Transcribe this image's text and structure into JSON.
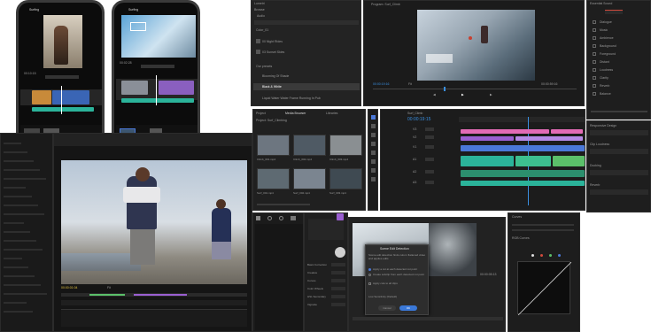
{
  "phones": {
    "left": {
      "title": "Surfing",
      "time": "00:10:15",
      "tools": [
        "Photos",
        "Media",
        "Text",
        "Audio"
      ]
    },
    "right": {
      "title": "Surfing",
      "time": "00:02:28",
      "tools": [
        "Photos",
        "Media",
        "Text",
        "Audio"
      ]
    }
  },
  "lumetri_list": {
    "header": "Lumetri",
    "tabs": [
      "Browse",
      "Audio"
    ],
    "section_title": "Color_01",
    "items": [
      "00 Night Rides",
      "03 Sunset Skies",
      "Run Sequences"
    ],
    "section2": "Our presets",
    "items2": [
      "Blooming Of Shade",
      "Black & White",
      "Liquid Water Water Frame Running In Pub"
    ]
  },
  "program_monitor": {
    "title": "Program: Surf_Climb",
    "timecode_left": "00:00:19:16",
    "timecode_right": "00:00:59:16",
    "fit": "Fit"
  },
  "project": {
    "title": "Project: Surf_Climbing",
    "tabs": [
      "Project",
      "Media Browser",
      "Libraries"
    ],
    "clip_labels": [
      "Climb_001.mp4",
      "Climb_002.mp4",
      "Climb_003.mp4",
      "Surf_001.mp4",
      "Surf_002.mp4",
      "Surf_003.mp4"
    ]
  },
  "timeline": {
    "title": "Surf_Climb",
    "timecode": "00:00:19:15",
    "tracks": [
      "V3",
      "V2",
      "V1",
      "A1",
      "A2",
      "A3"
    ]
  },
  "essential_sound": {
    "title": "Essential Sound",
    "items": [
      "Dialogue",
      "Music",
      "Ambience",
      "Background",
      "Foreground",
      "Distant",
      "Loudness",
      "Clarity",
      "Reverb",
      "Balance"
    ]
  },
  "essential_graphics": {
    "sections": [
      "Responsive Design",
      "Clip Loudness",
      "Ducking",
      "Reverb"
    ]
  },
  "scene_edit": {
    "title": "Scene Edit Detection",
    "text": "Scene edit detection finds cuts in flattened video and applies edits",
    "options": [
      "Apply a cut at each detected cut point",
      "Create subclip from each detected cut point",
      "Apply cuts to all clips"
    ],
    "sensitivity_label": "Low Sensitivity (Default)",
    "cancel": "Cancel",
    "ok": "OK"
  },
  "curves_panel": {
    "title": "Curves",
    "sub": "RGB Curves"
  },
  "kid_viewer": {
    "timecode": "00:00:01:04",
    "zoom": "Fit"
  },
  "lumetri_color": {
    "title": "Lumetri Color",
    "fields": [
      "Basic Correction",
      "Creative",
      "Curves",
      "Color Wheels",
      "HSL Secondary",
      "Vignette"
    ]
  },
  "colors": {
    "pink": "#e36bb5",
    "teal": "#2bb39a",
    "blue": "#4a78d8",
    "purple": "#9a5fd1",
    "green": "#5bc06a",
    "red": "#d24a3c"
  }
}
